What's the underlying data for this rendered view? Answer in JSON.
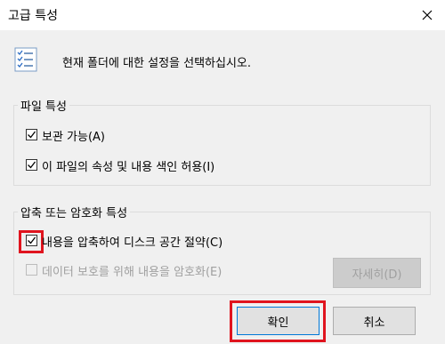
{
  "window": {
    "title": "고급 특성"
  },
  "header": {
    "description": "현재 폴더에 대한 설정을 선택하십시오."
  },
  "file_attributes": {
    "legend": "파일 특성",
    "archive": {
      "label": "보관 가능(A)",
      "checked": true
    },
    "index": {
      "label": "이 파일의 속성 및 내용 색인 허용(I)",
      "checked": true
    }
  },
  "compress_encrypt": {
    "legend": "압축 또는 암호화 특성",
    "compress": {
      "label": "내용을 압축하여 디스크 공간 절약(C)",
      "checked": true
    },
    "encrypt": {
      "label": "데이터 보호를 위해 내용을 암호화(E)",
      "checked": false,
      "disabled": true
    },
    "details_label": "자세히(D)"
  },
  "buttons": {
    "ok": "확인",
    "cancel": "취소"
  },
  "colors": {
    "highlight": "#e0141e",
    "focus": "#0078d7"
  }
}
